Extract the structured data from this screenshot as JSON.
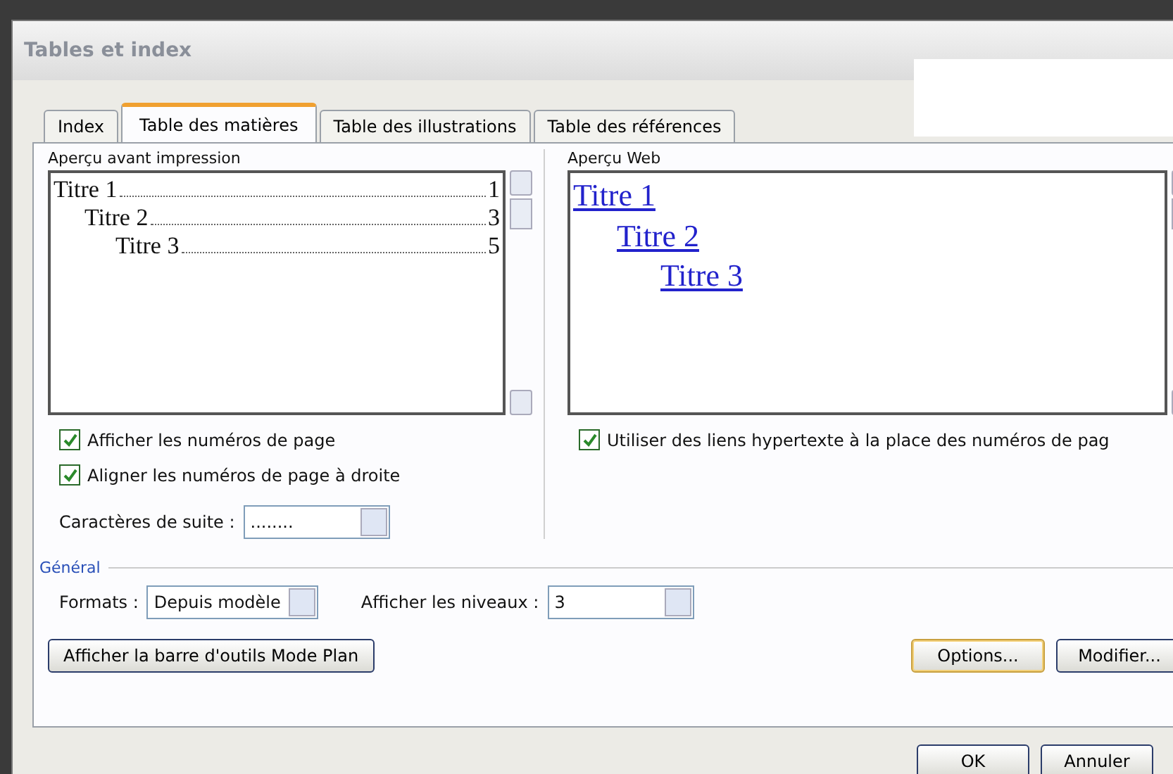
{
  "window": {
    "title": "Tables et index"
  },
  "tabs": [
    {
      "label": "Index",
      "selected": false
    },
    {
      "label": "Table des matières",
      "selected": true
    },
    {
      "label": "Table des illustrations",
      "selected": false
    },
    {
      "label": "Table des références",
      "selected": false
    }
  ],
  "print_preview": {
    "label": "Aperçu avant impression",
    "entries": [
      {
        "text": "Titre 1",
        "page": "1",
        "children": [
          {
            "text": "Titre 2",
            "page": "3",
            "children": [
              {
                "text": "Titre 3",
                "page": "5"
              }
            ]
          }
        ]
      }
    ]
  },
  "web_preview": {
    "label": "Aperçu Web",
    "entries": [
      {
        "text": "Titre 1",
        "children": [
          {
            "text": "Titre 2",
            "children": [
              {
                "text": "Titre 3"
              }
            ]
          }
        ]
      }
    ]
  },
  "left_options": [
    {
      "label": "Afficher les numéros de page",
      "checked": true
    },
    {
      "label": "Aligner les numéros de page à droite",
      "checked": true
    }
  ],
  "leader": {
    "label": "Caractères de suite :",
    "value": "........"
  },
  "right_options": [
    {
      "label": "Utiliser des liens hypertexte à la place des numéros de pag",
      "checked": true
    }
  ],
  "general": {
    "label": "Général",
    "formats_label": "Formats :",
    "formats_value": "Depuis modèle",
    "levels_label": "Afficher les niveaux :",
    "levels_value": "3"
  },
  "outline_button": "Afficher la barre d'outils Mode Plan",
  "buttons": [
    "Options...",
    "Modifier..."
  ],
  "footer_buttons": [
    "OK",
    "Annuler"
  ]
}
